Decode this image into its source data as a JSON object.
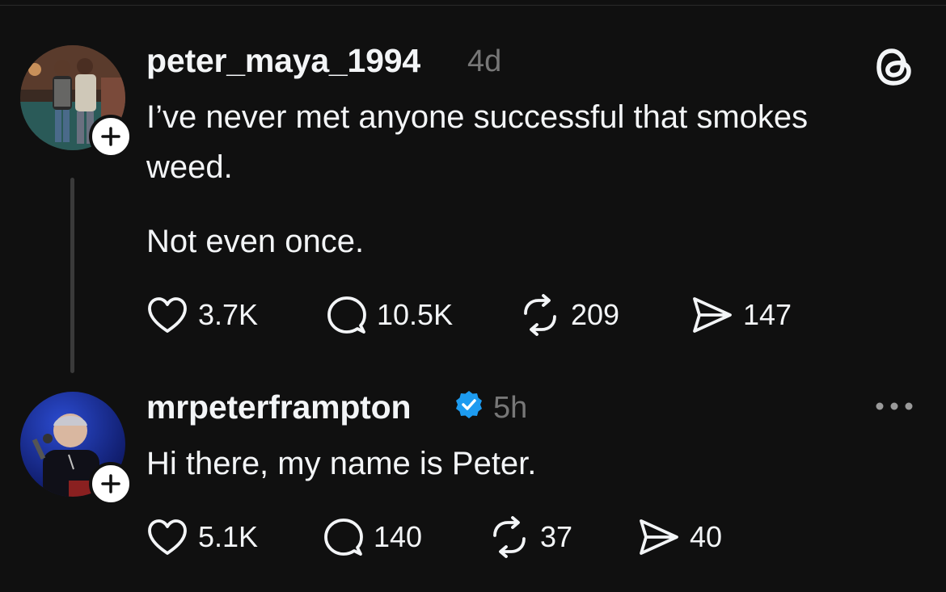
{
  "posts": [
    {
      "username": "peter_maya_1994",
      "time": "4d",
      "text_lines": [
        "I’ve never met anyone successful that smokes",
        "weed.",
        "Not even once."
      ],
      "actions": {
        "likes": "3.7K",
        "replies": "10.5K",
        "reposts": "209",
        "shares": "147"
      }
    },
    {
      "username": "mrpeterframpton",
      "verified": true,
      "time": "5h",
      "text_lines": [
        "Hi there, my name is Peter."
      ],
      "actions": {
        "likes": "5.1K",
        "replies": "140",
        "reposts": "37",
        "shares": "40"
      }
    }
  ],
  "icons": {
    "brand": "threads-logo-icon",
    "like": "heart-icon",
    "reply": "comment-icon",
    "repost": "repost-icon",
    "share": "send-icon",
    "follow": "plus-icon",
    "more": "more-icon",
    "verified": "verified-badge-icon"
  },
  "colors": {
    "background": "#101010",
    "text": "#f3f5f7",
    "muted": "#777777",
    "verified": "#1d9bf0"
  }
}
